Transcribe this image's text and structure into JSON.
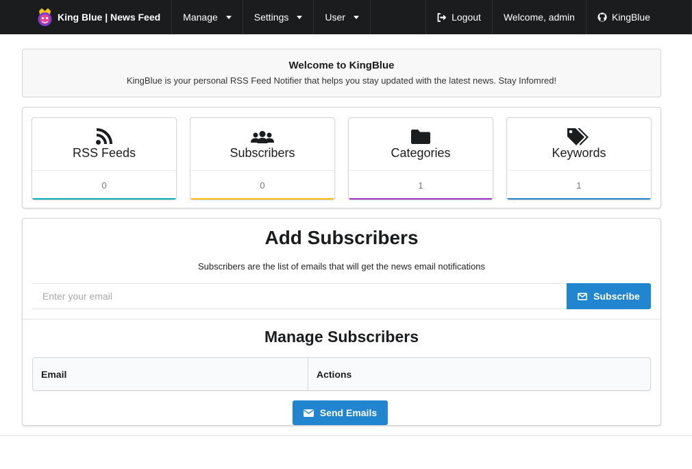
{
  "navbar": {
    "brand": "King Blue | News Feed",
    "menus": [
      {
        "label": "Manage"
      },
      {
        "label": "Settings"
      },
      {
        "label": "User"
      }
    ],
    "logout": "Logout",
    "welcome_user": "Welcome, admin",
    "github": "KingBlue"
  },
  "welcome": {
    "title": "Welcome to KingBlue",
    "text": "KingBlue is your personal RSS Feed Notifier that helps you stay updated with the latest news. Stay Infomred!"
  },
  "stats": [
    {
      "title": "RSS Feeds",
      "value": "0",
      "icon": "rss-icon",
      "color": "#00b5ad"
    },
    {
      "title": "Subscribers",
      "value": "0",
      "icon": "users-icon",
      "color": "#fbbd08"
    },
    {
      "title": "Categories",
      "value": "1",
      "icon": "folder-icon",
      "color": "#a333c8"
    },
    {
      "title": "Keywords",
      "value": "1",
      "icon": "tags-icon",
      "color": "#2185d0"
    }
  ],
  "subscribers": {
    "title": "Add Subscribers",
    "description": "Subscribers are the list of emails that will get the news email notifications",
    "input_placeholder": "Enter your email",
    "subscribe_label": "Subscribe",
    "manage_title": "Manage Subscribers",
    "table_headers": [
      "Email",
      "Actions"
    ],
    "send_label": "Send Emails"
  },
  "colors": {
    "navbar": "#1b1c1d",
    "primary": "#2185d0"
  }
}
